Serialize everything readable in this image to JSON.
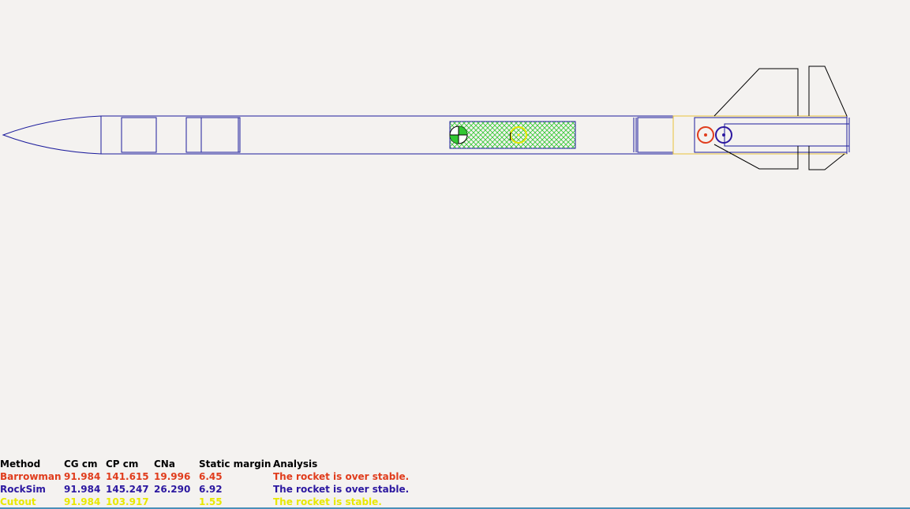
{
  "colors": {
    "background": "#f4f2f0",
    "body_outline": "#1c1c9c",
    "fin_outline": "#000000",
    "engine_outline": "#e8c23a",
    "mass_fill": "#32c832",
    "barrowman": "#e03c1c",
    "rocksim": "#2c18a0",
    "cutout": "#e8e800",
    "header": "#000000"
  },
  "table": {
    "headers": {
      "method": "Method",
      "cg": "CG cm",
      "cp": "CP cm",
      "cna": "CNa",
      "static_margin": "Static margin",
      "analysis": "Analysis"
    },
    "rows": [
      {
        "method": "Barrowman",
        "cg": "91.984",
        "cp": "141.615",
        "cna": "19.996",
        "static_margin": "6.45",
        "analysis": "The rocket is over stable.",
        "color": "#e03c1c"
      },
      {
        "method": "RockSim",
        "cg": "91.984",
        "cp": "145.247",
        "cna": "26.290",
        "static_margin": "6.92",
        "analysis": "The rocket is over stable.",
        "color": "#2c18a0"
      },
      {
        "method": "Cutout",
        "cg": "91.984",
        "cp": "103.917",
        "cna": "",
        "static_margin": "1.55",
        "analysis": "The rocket is stable.",
        "color": "#e8e800"
      }
    ]
  },
  "rocket": {
    "cutout_label": "[",
    "markers": [
      "cg-marker",
      "cp-barrowman-marker",
      "cp-rocksim-marker",
      "cp-cutout-marker"
    ]
  }
}
